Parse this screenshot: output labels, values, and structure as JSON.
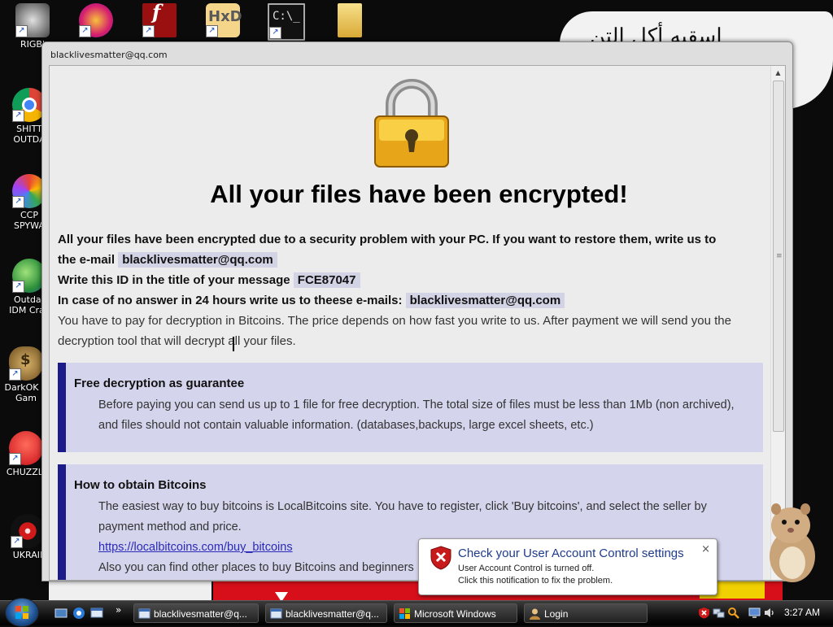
{
  "desktop": {
    "background_text": "اسقيه أكل التن",
    "icons": [
      {
        "name": "rigby-icon",
        "label_line1": "RIGB'",
        "label_line2": ""
      },
      {
        "name": "chrome-icon",
        "label_line1": "SHITT",
        "label_line2": "OUTDA"
      },
      {
        "name": "ccp-spyware-icon",
        "label_line1": "CCP",
        "label_line2": "SPYWA"
      },
      {
        "name": "idm-icon",
        "label_line1": "Outdat",
        "label_line2": "IDM Crac"
      },
      {
        "name": "darkok-icon",
        "label_line1": "DarkOK V",
        "label_line2": "Gam"
      },
      {
        "name": "chuzzle-icon",
        "label_line1": "CHUZZLI",
        "label_line2": ""
      },
      {
        "name": "ukraine-icon",
        "label_line1": "UKRAII",
        "label_line2": ""
      }
    ]
  },
  "window": {
    "title": "blacklivesmatter@qq.com",
    "headline": "All your files have been encrypted!",
    "line1": "All your files have been encrypted due to a security problem with your PC. If you want to restore them, write us to",
    "line2_prefix": "the e-mail",
    "email": "blacklivesmatter@qq.com",
    "line3_prefix": "Write this ID in the title of your message",
    "id_code": "FCE87047",
    "line4_prefix": "In case of no answer in 24 hours write us to theese e-mails:",
    "email2": "blacklivesmatter@qq.com",
    "line5": "You have to pay for decryption in Bitcoins. The price depends on how fast you write to us. After payment we will send you the",
    "line6": "decryption tool that will decrypt all your files.",
    "box1": {
      "title": "Free decryption as guarantee",
      "text1": "Before paying you can send us up to 1 file for free decryption. The total size of files must be less than 1Mb (non archived),",
      "text2": "and files should not contain valuable information. (databases,backups, large excel sheets, etc.)"
    },
    "box2": {
      "title": "How to obtain Bitcoins",
      "text1": "The easiest way to buy bitcoins is LocalBitcoins site. You have to register, click 'Buy bitcoins', and select the seller by",
      "text2": "payment method and price.",
      "link": "https://localbitcoins.com/buy_bitcoins",
      "text3": "Also you can find other places to buy Bitcoins and beginners"
    }
  },
  "uac": {
    "title": "Check your User Account Control settings",
    "line1": "User Account Control is turned off.",
    "line2": "Click this notification to fix the problem.",
    "close": "×"
  },
  "taskbar": {
    "buttons": [
      {
        "label": "blacklivesmatter@q..."
      },
      {
        "label": "blacklivesmatter@q..."
      },
      {
        "label": "Microsoft Windows"
      },
      {
        "label": "Login"
      }
    ],
    "overflow": "»",
    "clock": "3:27 AM"
  },
  "colors": {
    "box_accent": "#1b1b8a",
    "box_bg": "#d4d4ec",
    "highlight": "#d3d3e6",
    "uac_title": "#1e3b8c"
  }
}
